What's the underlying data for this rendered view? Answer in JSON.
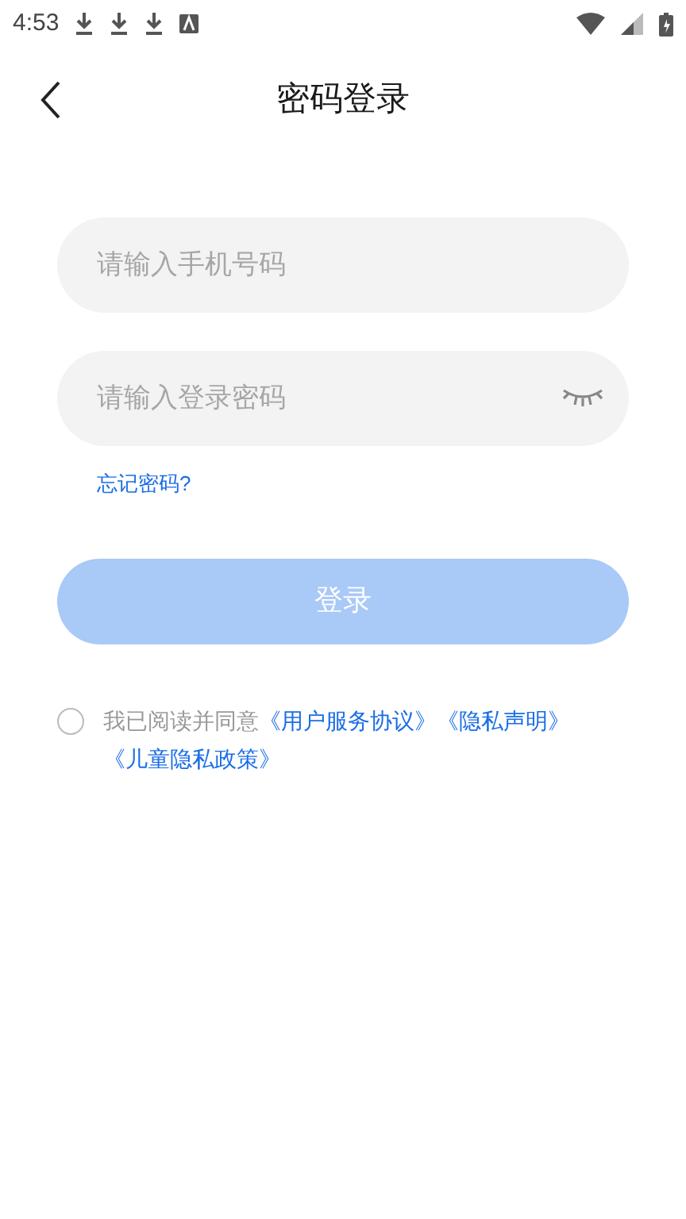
{
  "status_bar": {
    "time": "4:53"
  },
  "header": {
    "title": "密码登录"
  },
  "phone_field": {
    "placeholder": "请输入手机号码"
  },
  "password_field": {
    "placeholder": "请输入登录密码",
    "visible": false
  },
  "forgot_link": "忘记密码?",
  "login_button": {
    "label": "登录",
    "disabled": true
  },
  "agreement": {
    "checked": false,
    "prefix": "我已阅读并同意",
    "links": [
      "《用户服务协议》",
      "《隐私声明》",
      "《儿童隐私政策》"
    ]
  }
}
